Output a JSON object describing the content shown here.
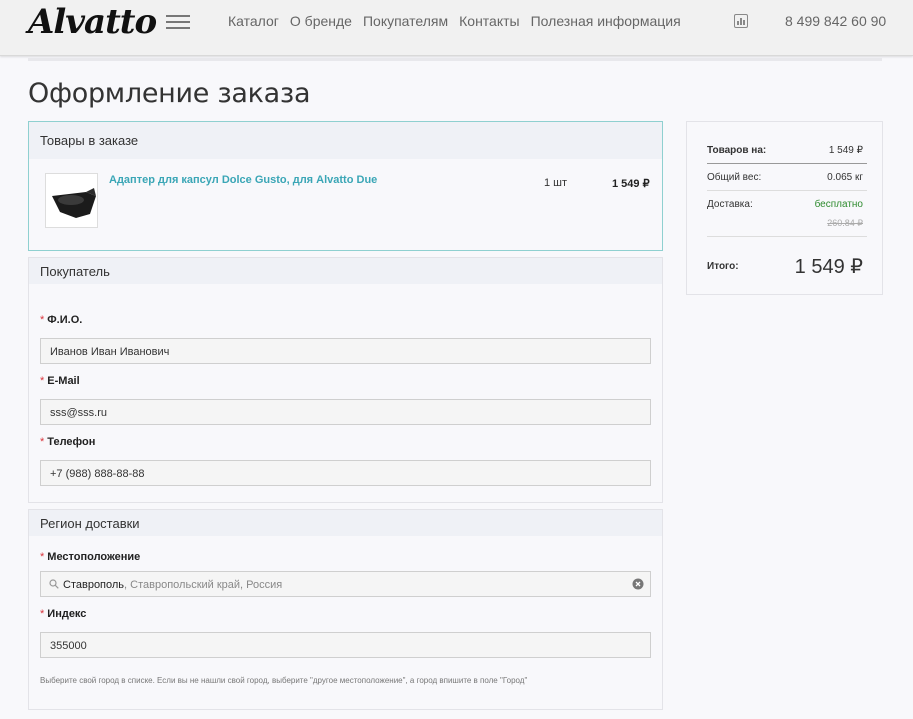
{
  "header": {
    "logo": "Alvatto",
    "nav": [
      "Каталог",
      "О бренде",
      "Покупателям",
      "Контакты",
      "Полезная информация"
    ],
    "phone": "8 499 842 60 90"
  },
  "page_title": "Оформление заказа",
  "order": {
    "title": "Товары в заказе",
    "item": {
      "name": "Адаптер для капсул Dolce Gusto, для Alvatto Due",
      "qty": "1 шт",
      "price": "1 549 ₽"
    }
  },
  "buyer": {
    "title": "Покупатель",
    "required_mark": "*",
    "fio_label": "Ф.И.О.",
    "fio_value": "Иванов Иван Иванович",
    "email_label": "E-Mail",
    "email_value": "sss@sss.ru",
    "phone_label": "Телефон",
    "phone_value": "+7 (988) 888-88-88"
  },
  "region": {
    "title": "Регион доставки",
    "location_label": "Местоположение",
    "location_city": "Ставрополь",
    "location_rest": ", Ставропольский край, Россия",
    "index_label": "Индекс",
    "index_value": "355000",
    "hint": "Выберите свой город в списке. Если вы не нашли свой город, выберите \"другое местоположение\", а город впишите в поле \"Город\""
  },
  "summary": {
    "goods_label": "Товаров на:",
    "goods_value": "1 549 ₽",
    "weight_label": "Общий вес:",
    "weight_value": "0.065 кг",
    "delivery_label": "Доставка:",
    "delivery_value": "бесплатно",
    "delivery_old": "260.84 ₽",
    "total_label": "Итого:",
    "total_value": "1 549 ₽"
  },
  "colors": {
    "accent": "#3aa6b6",
    "required": "#d9343c",
    "free": "#2e8b2e"
  }
}
